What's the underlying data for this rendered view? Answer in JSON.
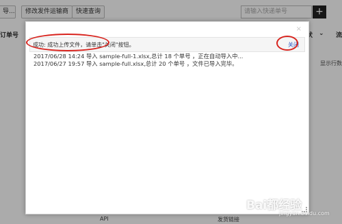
{
  "toolbar": {
    "dropdown_label": "导...",
    "edit_tracking_label": "修改发件运输商",
    "quick_query_label": "快速查询",
    "search_placeholder": "请输入快递单号",
    "add_label": "+"
  },
  "table_header": {
    "col_order_no": "订单号",
    "col_status": "状",
    "col_tail": "流"
  },
  "background": {
    "display_rows_text": "显示行数"
  },
  "footer": {
    "api": "API",
    "send_link": "发货链接"
  },
  "modal": {
    "close_x": "×",
    "success_message": "成功: 成功上传文件，请单击\"关闭\"按钮。",
    "close_link": "关闭",
    "log_lines": [
      "2017/06/28 14:24 导入 sample-full-1.xlsx,总计 18 个单号 ，正在自动导入中...",
      "2017/06/27 19:57 导入 sample-full.xlsx,总计 20 个单号 ，文件已导入完毕。"
    ]
  },
  "watermark": {
    "logo_text": "Bai都经验",
    "sub_text": "jingyan.baidu.com"
  }
}
